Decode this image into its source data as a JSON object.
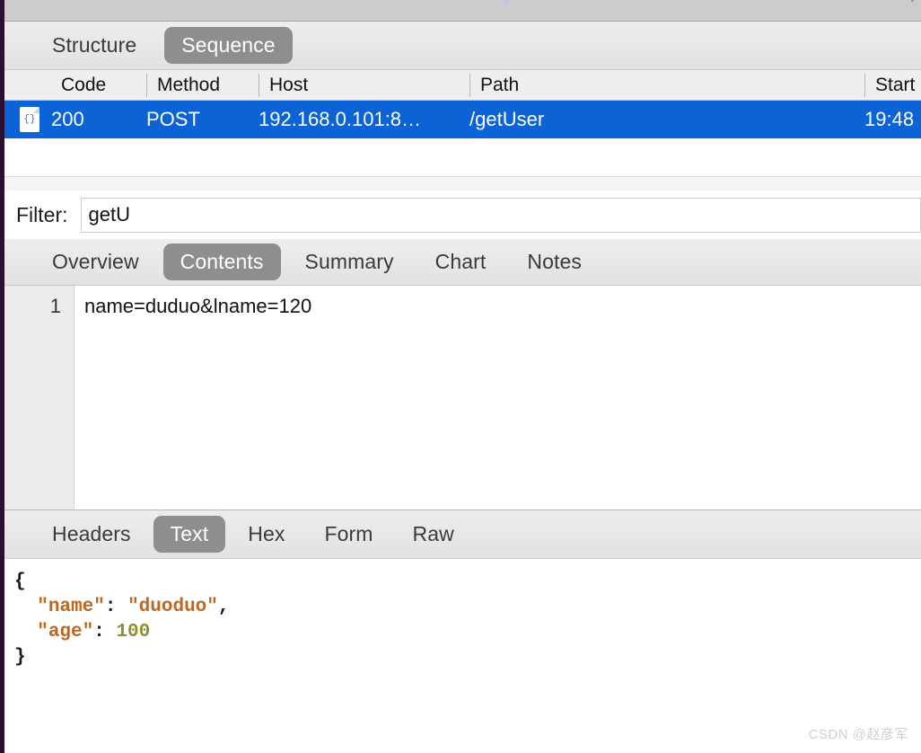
{
  "window": {
    "chrome_present": true
  },
  "primary_tabs": {
    "items": [
      {
        "label": "Structure",
        "active": false
      },
      {
        "label": "Sequence",
        "active": true
      }
    ]
  },
  "request_table": {
    "columns": [
      "Code",
      "Method",
      "Host",
      "Path",
      "Start"
    ],
    "rows": [
      {
        "icon": "json-document-icon",
        "code": "200",
        "method": "POST",
        "host": "192.168.0.101:8…",
        "path": "/getUser",
        "start": "19:48",
        "selected": true
      }
    ]
  },
  "filter": {
    "label": "Filter:",
    "value": "getU",
    "placeholder": ""
  },
  "detail_tabs": {
    "items": [
      {
        "label": "Overview",
        "active": false
      },
      {
        "label": "Contents",
        "active": true
      },
      {
        "label": "Summary",
        "active": false
      },
      {
        "label": "Chart",
        "active": false
      },
      {
        "label": "Notes",
        "active": false
      }
    ]
  },
  "request_contents": {
    "line_numbers": [
      "1"
    ],
    "lines": [
      "name=duduo&lname=120"
    ]
  },
  "body_tabs": {
    "items": [
      {
        "label": "Headers",
        "active": false
      },
      {
        "label": "Text",
        "active": true
      },
      {
        "label": "Hex",
        "active": false
      },
      {
        "label": "Form",
        "active": false
      },
      {
        "label": "Raw",
        "active": false
      }
    ]
  },
  "response_body": {
    "open_brace": "{",
    "close_brace": "}",
    "entries": [
      {
        "key": "\"name\"",
        "colon": ": ",
        "value": "\"duoduo\"",
        "value_type": "string",
        "trailing": ","
      },
      {
        "key": "\"age\"",
        "colon": ": ",
        "value": "100",
        "value_type": "number",
        "trailing": ""
      }
    ]
  },
  "watermark": {
    "text": "CSDN @赵彦军"
  },
  "colors": {
    "selection_blue": "#0b63d6",
    "active_tab_gray": "#8e8e8e",
    "toolbar_gray": "#e6e6e6",
    "json_orange": "#c2661c",
    "json_olive": "#8f8f2e",
    "left_edge": "#2a1030"
  }
}
